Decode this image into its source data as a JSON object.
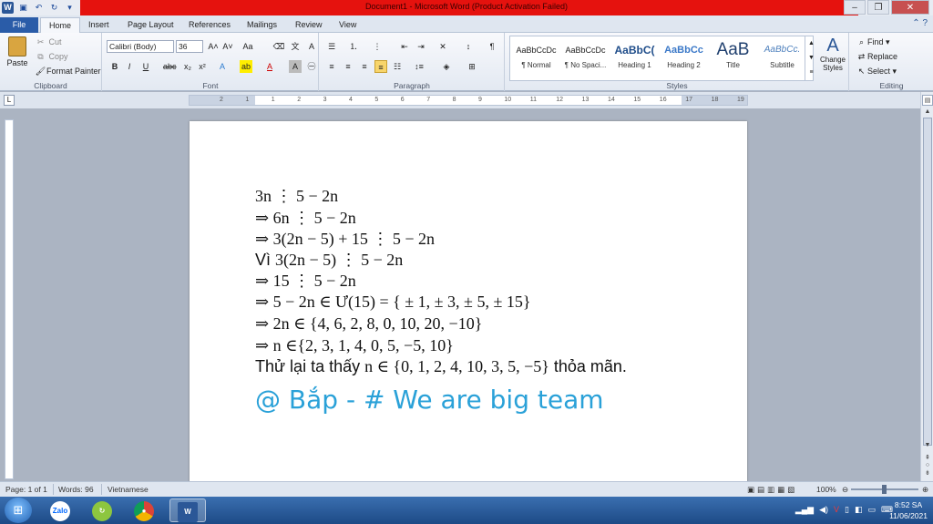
{
  "window": {
    "title": "Document1  -  Microsoft Word (Product Activation Failed)",
    "accent_color": "#e5120e"
  },
  "ribbon_tabs": [
    "File",
    "Home",
    "Insert",
    "Page Layout",
    "References",
    "Mailings",
    "Review",
    "View"
  ],
  "clipboard": {
    "paste": "Paste",
    "cut": "Cut",
    "copy": "Copy",
    "format_painter": "Format Painter",
    "label": "Clipboard"
  },
  "font": {
    "family": "Calibri (Body)",
    "size": "36",
    "label": "Font"
  },
  "paragraph": {
    "label": "Paragraph"
  },
  "styles": {
    "label": "Styles",
    "items": [
      {
        "preview": "AaBbCcDc",
        "name": "¶ Normal"
      },
      {
        "preview": "AaBbCcDc",
        "name": "¶ No Spaci..."
      },
      {
        "preview": "AaBbC(",
        "name": "Heading 1"
      },
      {
        "preview": "AaBbCc",
        "name": "Heading 2"
      },
      {
        "preview": "AaB",
        "name": "Title"
      },
      {
        "preview": "AaBbCc.",
        "name": "Subtitle"
      }
    ],
    "change_styles": "Change Styles"
  },
  "editing": {
    "label": "Editing",
    "find": "Find",
    "replace": "Replace",
    "select": "Select"
  },
  "ruler_ticks": [
    "2",
    "1",
    "1",
    "2",
    "3",
    "4",
    "5",
    "6",
    "7",
    "8",
    "9",
    "10",
    "11",
    "12",
    "13",
    "14",
    "15",
    "16",
    "17",
    "18",
    "19"
  ],
  "document": {
    "lines": [
      "3n ⋮ 5 − 2n",
      "⇒ 6n ⋮ 5 − 2n",
      "⇒ 3(2n − 5) + 15 ⋮ 5 − 2n",
      "3(2n −  5) ⋮  5 − 2n",
      "⇒ 15 ⋮ 5 − 2n",
      "⇒ 5 − 2n ∈ Ư(15) = { ± 1, ± 3, ± 5, ± 15}",
      "⇒ 2n ∈ {4, 6, 2, 8, 0, 10, 20, −10}",
      "⇒ n ∈{2, 3, 1, 4, 0, 5, −5, 10}",
      "n ∈ {0, 1, 2, 4, 10, 3, 5, −5}"
    ],
    "line4_prefix": "Vì ",
    "line9_prefix": "Thử lại ta thấy ",
    "line9_suffix": " thỏa mãn.",
    "signature": "@ Bắp - # We are big team",
    "signature_color": "#2aa1d8"
  },
  "status": {
    "page": "Page: 1 of 1",
    "words": "Words: 96",
    "language": "Vietnamese",
    "zoom": "100%"
  },
  "taskbar": {
    "apps": [
      "Zalo"
    ],
    "time": "8:52 SA",
    "date": "11/06/2021"
  }
}
